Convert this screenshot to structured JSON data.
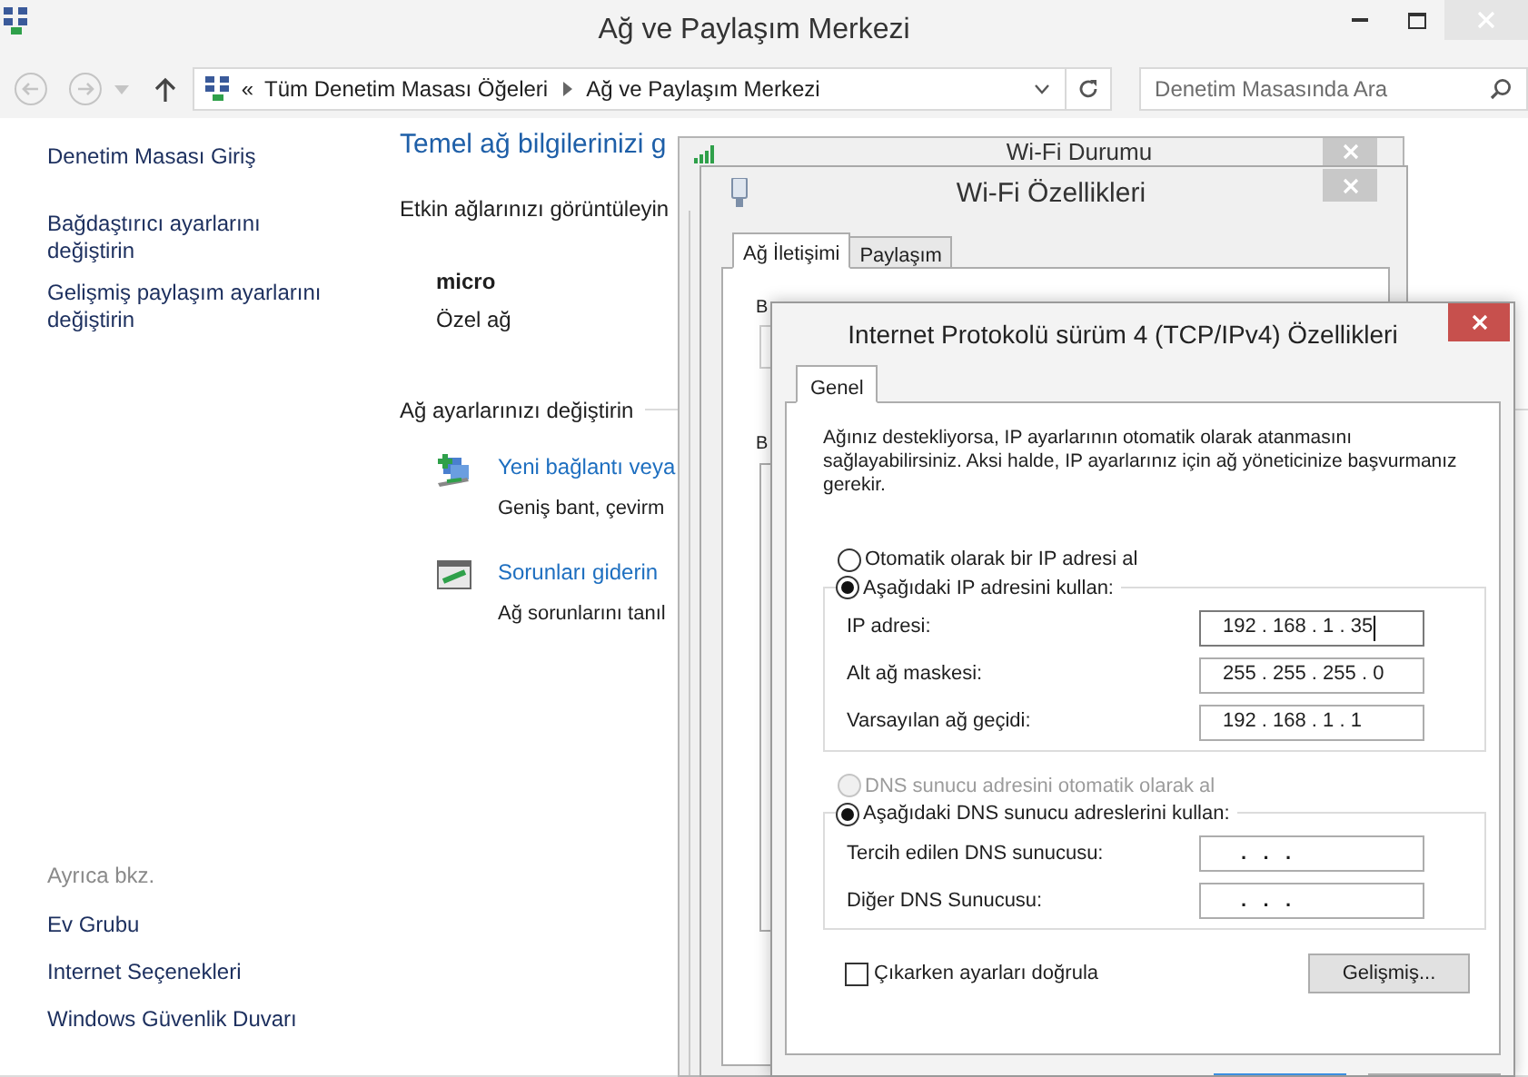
{
  "main_window": {
    "title": "Ağ ve Paylaşım Merkezi",
    "address_bar": {
      "prefix": "«",
      "breadcrumbs": [
        "Tüm Denetim Masası Öğeleri",
        "Ağ ve Paylaşım Merkezi"
      ]
    },
    "search": {
      "placeholder": "Denetim Masasında Ara"
    },
    "sidebar": {
      "links": [
        "Denetim Masası Giriş",
        "Bağdaştırıcı ayarlarını değiştirin",
        "Gelişmiş paylaşım ayarlarını değiştirin"
      ],
      "see_also": {
        "heading": "Ayrıca bkz.",
        "links": [
          "Ev Grubu",
          "Internet Seçenekleri",
          "Windows Güvenlik Duvarı"
        ]
      }
    },
    "content": {
      "heading": "Temel ağ bilgilerinizi g",
      "active_networks_label": "Etkin ağlarınızı görüntüleyin",
      "network": {
        "name": "micro",
        "type": "Özel ağ"
      },
      "change_label": "Ağ ayarlarınızı değiştirin",
      "tasks": [
        {
          "kind": "new-connection",
          "title": "Yeni bağlantı veya",
          "description": "Geniş bant, çevirm"
        },
        {
          "kind": "troubleshoot",
          "title": "Sorunları giderin",
          "description": "Ağ sorunlarını tanıl"
        }
      ]
    }
  },
  "wifi_status_window": {
    "title": "Wi-Fi Durumu"
  },
  "wifi_properties_window": {
    "title": "Wi-Fi Özellikleri",
    "tabs": [
      {
        "label": "Ağ İletişimi",
        "selected": true
      },
      {
        "label": "Paylaşım",
        "selected": false
      }
    ],
    "labels": [
      "B",
      "B"
    ]
  },
  "ipv4_window": {
    "title": "Internet Protokolü sürüm 4 (TCP/IPv4) Özellikleri",
    "tabs": [
      {
        "label": "Genel",
        "selected": true
      }
    ],
    "description": "Ağınız destekliyorsa, IP ayarlarının otomatik olarak atanmasını sağlayabilirsiniz. Aksi halde, IP ayarlarınız için ağ yöneticinize başvurmanız gerekir.",
    "ip_options": [
      {
        "label": "Otomatik olarak bir IP adresi al",
        "selected": false,
        "disabled": false
      },
      {
        "label": "Aşağıdaki IP adresini kullan:",
        "selected": true,
        "disabled": false
      }
    ],
    "ip_fields": [
      {
        "label": "IP adresi:",
        "value": "192 . 168 . 1 . 35",
        "focused": true
      },
      {
        "label": "Alt ağ maskesi:",
        "value": "255 . 255 . 255 . 0",
        "focused": false
      },
      {
        "label": "Varsayılan ağ geçidi:",
        "value": "192 . 168 . 1 . 1",
        "focused": false
      }
    ],
    "dns_options": [
      {
        "label": "DNS sunucu adresini otomatik olarak al",
        "selected": false,
        "disabled": true
      },
      {
        "label": "Aşağıdaki DNS sunucu adreslerini kullan:",
        "selected": true,
        "disabled": false
      }
    ],
    "dns_fields": [
      {
        "label": "Tercih edilen DNS sunucusu:",
        "value": ".   .   .",
        "focused": false
      },
      {
        "label": "Diğer DNS Sunucusu:",
        "value": ".   .   .",
        "focused": false
      }
    ],
    "validate_on_exit": {
      "label": "Çıkarken ayarları doğrula",
      "checked": false
    },
    "advanced_button": "Gelişmiş..."
  }
}
